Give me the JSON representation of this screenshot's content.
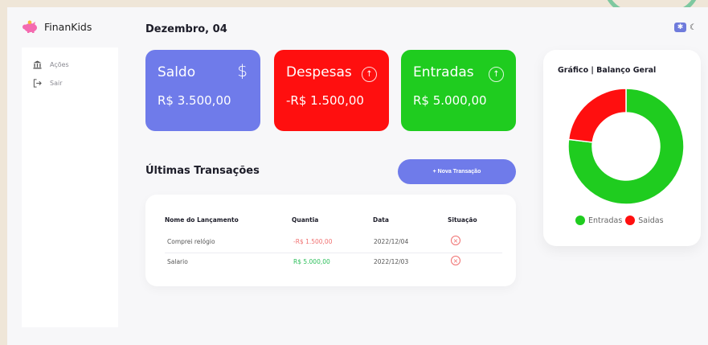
{
  "brand": {
    "name": "FinanKids",
    "icon": "piggy-bank-icon"
  },
  "sidebar": {
    "items": [
      {
        "label": "Ações",
        "icon": "bank-icon"
      },
      {
        "label": "Sair",
        "icon": "logout-icon"
      }
    ]
  },
  "header": {
    "date": "Dezembro, 04"
  },
  "cards": {
    "saldo": {
      "title": "Saldo",
      "value": "R$ 3.500,00",
      "icon": "dollar-icon",
      "color": "#6f7bea"
    },
    "despesas": {
      "title": "Despesas",
      "value": "-R$ 1.500,00",
      "icon": "arrow-up-circle-icon",
      "color": "#ff0f0f"
    },
    "entradas": {
      "title": "Entradas",
      "value": "R$ 5.000,00",
      "icon": "arrow-up-circle-icon",
      "color": "#1fcc1f"
    }
  },
  "transactions": {
    "title": "Últimas Transações",
    "new_button": "+ Nova Transação",
    "headers": [
      "Nome do Lançamento",
      "Quantia",
      "Data",
      "Situação"
    ],
    "rows": [
      {
        "name": "Comprei relógio",
        "amount": "-R$ 1.500,00",
        "date": "2022/12/04",
        "amount_color": "#f07070"
      },
      {
        "name": "Salario",
        "amount": "R$ 5.000,00",
        "date": "2022/12/03",
        "amount_color": "#2bbf5a"
      }
    ]
  },
  "chart": {
    "title": "Gráfico | Balanço Geral",
    "legend": [
      "Entradas",
      "Saidas"
    ]
  },
  "chart_data": {
    "type": "pie",
    "title": "Gráfico | Balanço Geral",
    "categories": [
      "Entradas",
      "Saidas"
    ],
    "values": [
      5000,
      1500
    ],
    "colors": [
      "#1fcc1f",
      "#ff0f0f"
    ],
    "legend_position": "bottom"
  }
}
